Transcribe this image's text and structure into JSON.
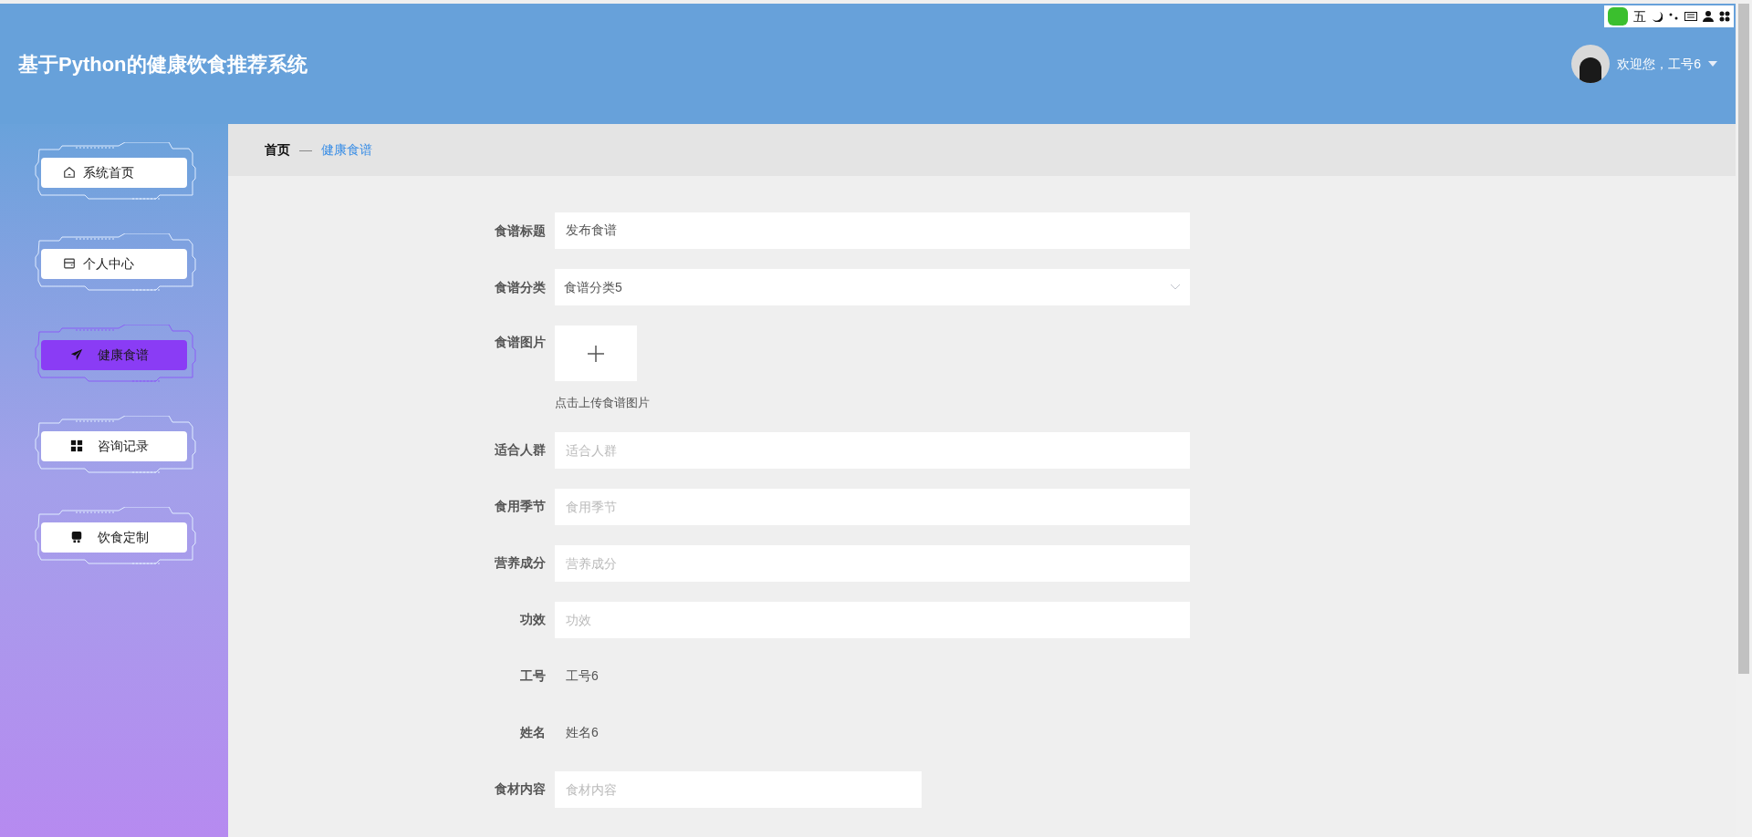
{
  "header": {
    "title": "基于Python的健康饮食推荐系统",
    "greeting": "欢迎您，工号6"
  },
  "ime_toolbar": {
    "mode": "五"
  },
  "sidebar": {
    "items": [
      {
        "label": "系统首页",
        "selected": false
      },
      {
        "label": "个人中心",
        "selected": false
      },
      {
        "label": "健康食谱",
        "selected": true
      },
      {
        "label": "咨询记录",
        "selected": false
      },
      {
        "label": "饮食定制",
        "selected": false
      }
    ]
  },
  "breadcrumb": {
    "separator": "—",
    "items": [
      {
        "label": "首页",
        "selected": false
      },
      {
        "label": "健康食谱",
        "selected": true
      }
    ]
  },
  "form": {
    "fields": [
      {
        "kind": "text",
        "label": "食谱标题",
        "value": "发布食谱"
      },
      {
        "kind": "select",
        "label": "食谱分类",
        "value": "食谱分类5"
      },
      {
        "kind": "upload",
        "label": "食谱图片",
        "hint": "点击上传食谱图片"
      },
      {
        "kind": "text",
        "label": "适合人群",
        "placeholder": "适合人群"
      },
      {
        "kind": "text",
        "label": "食用季节",
        "placeholder": "食用季节"
      },
      {
        "kind": "text",
        "label": "营养成分",
        "placeholder": "营养成分"
      },
      {
        "kind": "text",
        "label": "功效",
        "placeholder": "功效"
      },
      {
        "kind": "static",
        "label": "工号",
        "value": "工号6"
      },
      {
        "kind": "static",
        "label": "姓名",
        "value": "姓名6"
      },
      {
        "kind": "short",
        "label": "食材内容",
        "placeholder": "食材内容"
      }
    ]
  }
}
